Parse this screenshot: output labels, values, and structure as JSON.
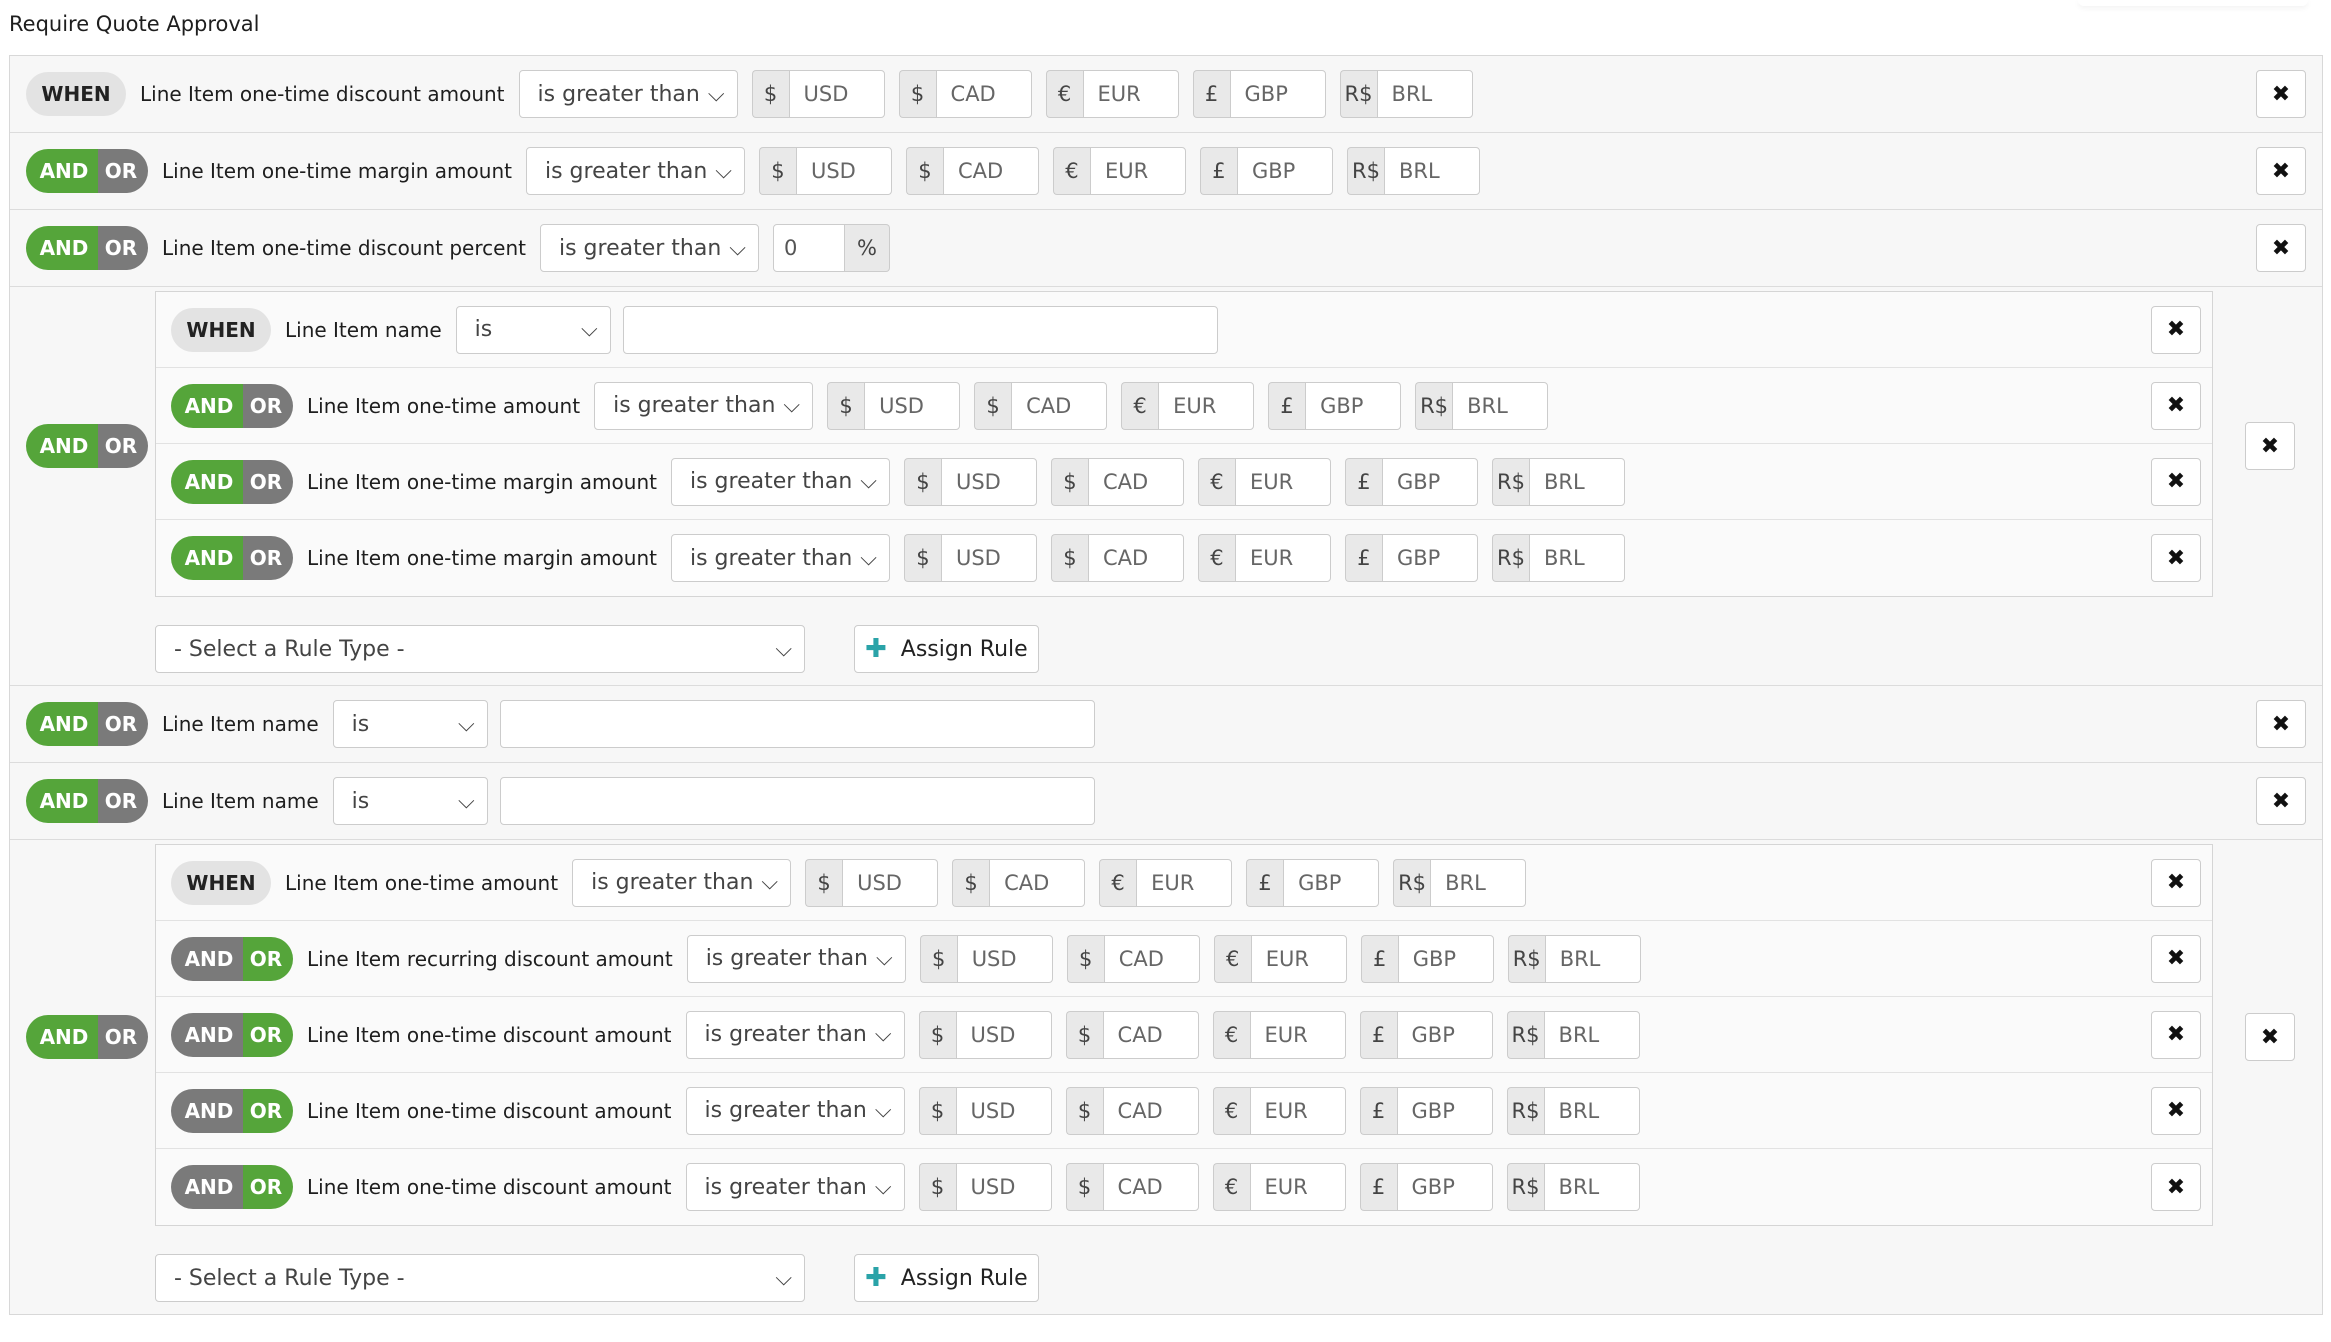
{
  "page_title": "Require Quote Approval",
  "labels": {
    "when": "WHEN",
    "and": "AND",
    "or": "OR",
    "close_icon": "✖",
    "chevron_icon": "⌵",
    "plus_icon": "✚",
    "percent": "%"
  },
  "currencies": [
    {
      "symbol": "$",
      "code": "USD"
    },
    {
      "symbol": "$",
      "code": "CAD"
    },
    {
      "symbol": "€",
      "code": "EUR"
    },
    {
      "symbol": "£",
      "code": "GBP"
    },
    {
      "symbol": "R$",
      "code": "BRL"
    }
  ],
  "footer": {
    "rule_type_placeholder": "- Select a Rule Type -",
    "assign_label": "Assign Rule"
  },
  "colors": {
    "and_or_active": "#55a53a",
    "and_or_inactive": "#7a7a7a",
    "assign_plus": "#2aa3a8"
  },
  "rows": [
    {
      "type": "cond",
      "prefix": "when",
      "field": "Line Item one-time discount amount",
      "op": "is greater than",
      "value_type": "currency"
    },
    {
      "type": "cond",
      "prefix": "and",
      "field": "Line Item one-time margin amount",
      "op": "is greater than",
      "value_type": "currency"
    },
    {
      "type": "cond",
      "prefix": "and",
      "field": "Line Item one-time discount percent",
      "op": "is greater than",
      "value_type": "percent",
      "value": "0"
    },
    {
      "type": "group",
      "prefix": "and",
      "rows": [
        {
          "prefix": "when",
          "field": "Line Item name",
          "op": "is",
          "value_type": "text"
        },
        {
          "prefix": "and",
          "field": "Line Item one-time amount",
          "op": "is greater than",
          "value_type": "currency"
        },
        {
          "prefix": "and",
          "field": "Line Item one-time margin amount",
          "op": "is greater than",
          "value_type": "currency"
        },
        {
          "prefix": "and",
          "field": "Line Item one-time margin amount",
          "op": "is greater than",
          "value_type": "currency"
        }
      ]
    },
    {
      "type": "cond",
      "prefix": "and",
      "field": "Line Item name",
      "op": "is",
      "value_type": "text"
    },
    {
      "type": "cond",
      "prefix": "and",
      "field": "Line Item name",
      "op": "is",
      "value_type": "text"
    },
    {
      "type": "group",
      "prefix": "and",
      "rows": [
        {
          "prefix": "when",
          "field": "Line Item one-time amount",
          "op": "is greater than",
          "value_type": "currency"
        },
        {
          "prefix": "or",
          "field": "Line Item recurring discount amount",
          "op": "is greater than",
          "value_type": "currency"
        },
        {
          "prefix": "or",
          "field": "Line Item one-time discount amount",
          "op": "is greater than",
          "value_type": "currency"
        },
        {
          "prefix": "or",
          "field": "Line Item one-time discount amount",
          "op": "is greater than",
          "value_type": "currency"
        },
        {
          "prefix": "or",
          "field": "Line Item one-time discount amount",
          "op": "is greater than",
          "value_type": "currency"
        }
      ]
    }
  ]
}
